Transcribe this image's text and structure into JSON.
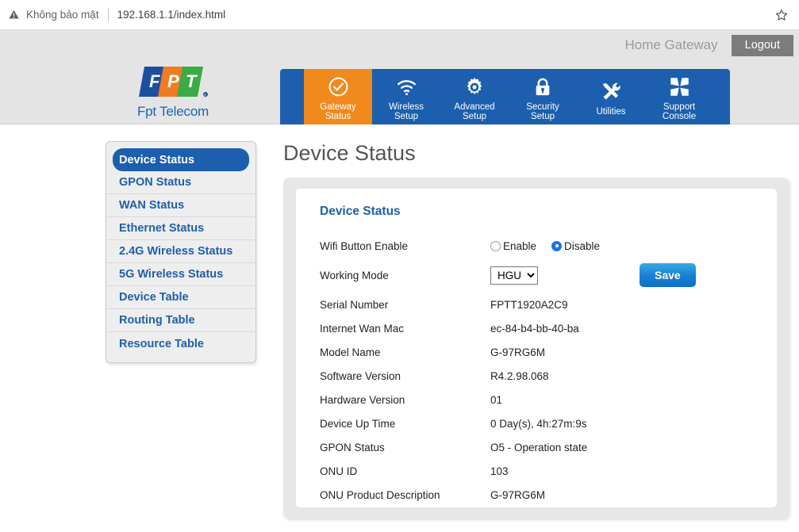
{
  "browser": {
    "security_label": "Không bảo mật",
    "url": "192.168.1.1/index.html",
    "warning_icon": "warning-triangle-icon",
    "bookmark_icon": "star-outline-icon"
  },
  "header": {
    "account_label": "Home Gateway",
    "logout_label": "Logout",
    "logo_text": "Fpt Telecom",
    "logo_letters": [
      "F",
      "P",
      "T"
    ],
    "logo_colors": [
      "#1d4f9e",
      "#f07c22",
      "#3bab47"
    ]
  },
  "nav": {
    "items": [
      {
        "label_line1": "Gateway",
        "label_line2": "Status",
        "icon": "check-circle-icon",
        "active": true
      },
      {
        "label_line1": "Wireless",
        "label_line2": "Setup",
        "icon": "wifi-icon",
        "active": false
      },
      {
        "label_line1": "Advanced",
        "label_line2": "Setup",
        "icon": "gear-icon",
        "active": false
      },
      {
        "label_line1": "Security",
        "label_line2": "Setup",
        "icon": "lock-icon",
        "active": false
      },
      {
        "label_line1": "Utilities",
        "label_line2": "",
        "icon": "tools-icon",
        "active": false
      },
      {
        "label_line1": "Support",
        "label_line2": "Console",
        "icon": "collapse-arrows-icon",
        "active": false
      }
    ],
    "active_color": "#f08a1c",
    "bar_color": "#1c5fae"
  },
  "sidebar": {
    "items": [
      {
        "label": "Device Status",
        "active": true
      },
      {
        "label": "GPON Status",
        "active": false
      },
      {
        "label": "WAN Status",
        "active": false
      },
      {
        "label": "Ethernet Status",
        "active": false
      },
      {
        "label": "2.4G Wireless Status",
        "active": false
      },
      {
        "label": "5G Wireless Status",
        "active": false
      },
      {
        "label": "Device Table",
        "active": false
      },
      {
        "label": "Routing Table",
        "active": false
      },
      {
        "label": "Resource Table",
        "active": false
      }
    ]
  },
  "main": {
    "page_title": "Device Status",
    "card_title": "Device Status",
    "wifi_button": {
      "label": "Wifi Button Enable",
      "enable_label": "Enable",
      "disable_label": "Disable",
      "selected": "Disable"
    },
    "working_mode": {
      "label": "Working Mode",
      "value": "HGU",
      "options": [
        "HGU"
      ]
    },
    "save_label": "Save",
    "info_rows": [
      {
        "label": "Serial Number",
        "value": "FPTT1920A2C9"
      },
      {
        "label": "Internet Wan Mac",
        "value": "ec-84-b4-bb-40-ba"
      },
      {
        "label": "Model Name",
        "value": "G-97RG6M"
      },
      {
        "label": "Software Version",
        "value": "R4.2.98.068"
      },
      {
        "label": "Hardware Version",
        "value": "01"
      },
      {
        "label": "Device Up Time",
        "value": "0 Day(s), 4h:27m:9s"
      },
      {
        "label": "GPON Status",
        "value": "O5 - Operation state"
      },
      {
        "label": "ONU ID",
        "value": "103"
      },
      {
        "label": "ONU Product Description",
        "value": "G-97RG6M"
      }
    ]
  }
}
